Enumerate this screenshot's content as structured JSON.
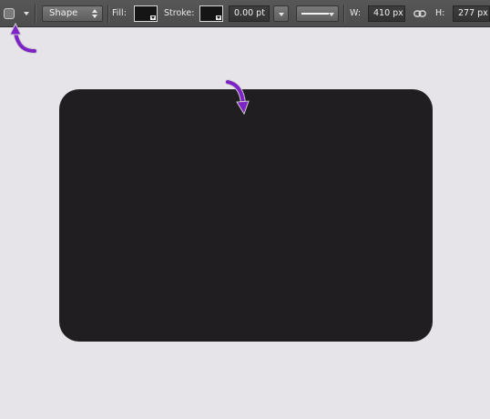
{
  "toolbar": {
    "tool_icon": "rounded-rectangle-tool-icon",
    "tool_mode": "Shape",
    "fill_label": "Fill:",
    "fill_color": "#151515",
    "stroke_label": "Stroke:",
    "stroke_color": "#151515",
    "stroke_width": "0.00 pt",
    "width_label": "W:",
    "width_value": "410 px",
    "link_icon": "link-icon",
    "height_label": "H:",
    "height_value": "277 px"
  },
  "canvas": {
    "background": "#e6e4e8",
    "shape_color": "#201e20"
  },
  "annotations": {
    "arrow_color": "#7d22c4"
  }
}
